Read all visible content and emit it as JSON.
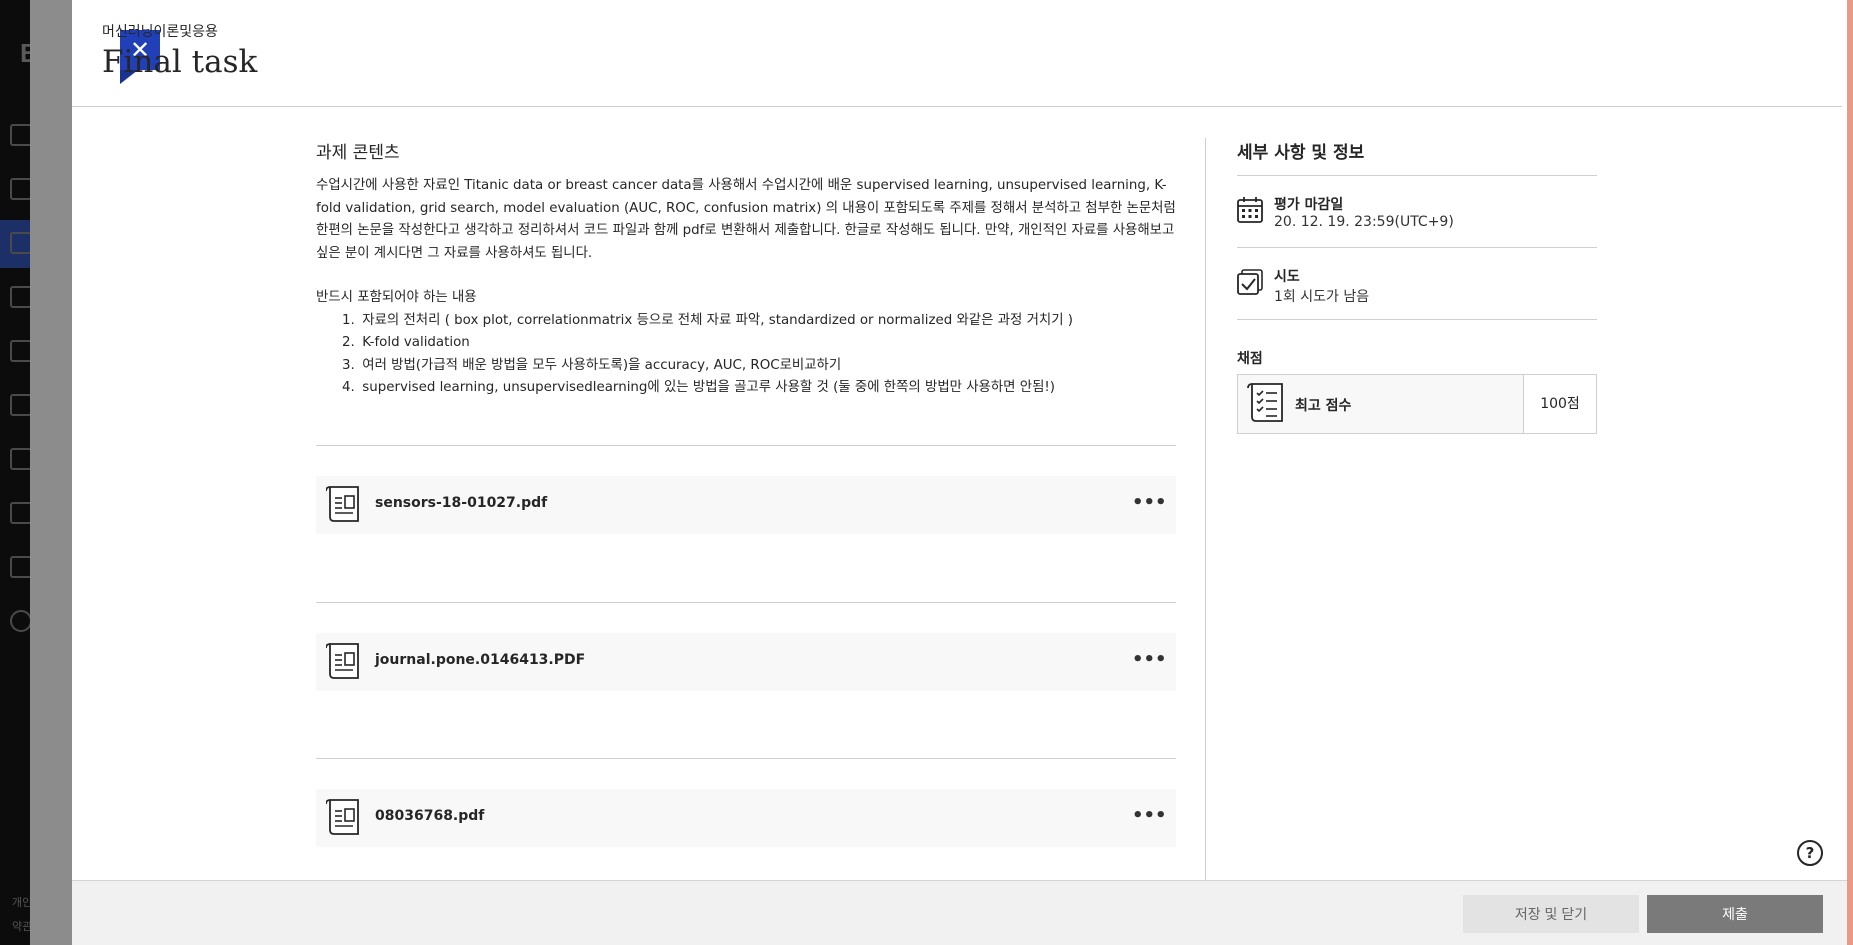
{
  "background": {
    "footer_lines": [
      "개인",
      "약관"
    ]
  },
  "header": {
    "close_symbol": "✕",
    "course_name": "머신러닝이론및응용",
    "title": "Final task"
  },
  "content": {
    "section_title": "과제 콘텐츠",
    "description": "수업시간에 사용한 자료인 Titanic data or breast cancer data를 사용해서 수업시간에 배운 supervised learning, unsupervised learning, K-fold validation, grid search, model evaluation (AUC, ROC, confusion matrix) 의 내용이 포함되도록 주제를 정해서 분석하고 첨부한 논문처럼 한편의 논문을 작성한다고 생각하고 정리하셔서 코드 파일과 함께 pdf로 변환해서 제출합니다. 한글로 작성해도 됩니다. 만약, 개인적인 자료를 사용해보고 싶은 분이 계시다면 그 자료를 사용하셔도 됩니다.",
    "requirements_title": "반드시 포함되어야 하는 내용",
    "requirements": [
      {
        "num": "1.",
        "text": "자료의 전처리 ( box plot, correlationmatrix 등으로 전체 자료 파악, standardized or normalized 와같은 과정 거치기 )"
      },
      {
        "num": "2.",
        "text": "K-fold validation"
      },
      {
        "num": "3.",
        "text": "여러 방법(가급적 배운 방법을 모두 사용하도록)을 accuracy, AUC, ROC로비교하기"
      },
      {
        "num": "4.",
        "text": "supervised learning, unsupervisedlearning에 있는 방법을 골고루 사용할 것 (둘 중에 한쪽의 방법만 사용하면 안됨!)"
      }
    ],
    "files": [
      {
        "name": "sensors-18-01027.pdf",
        "more": "•••"
      },
      {
        "name": "journal.pone.0146413.PDF",
        "more": "•••"
      },
      {
        "name": "08036768.pdf",
        "more": "•••"
      }
    ]
  },
  "sidebar": {
    "title": "세부 사항 및 정보",
    "due": {
      "label": "평가 마감일",
      "value": "20. 12. 19. 23:59(UTC+9)"
    },
    "attempts": {
      "label": "시도",
      "value": "1회 시도가 남음"
    },
    "grading_label": "채점",
    "max_score": {
      "label": "최고 점수",
      "value": "100점"
    }
  },
  "help": {
    "symbol": "?"
  },
  "footer": {
    "save_label": "저장 및 닫기",
    "submit_label": "제출"
  },
  "colors": {
    "accent": "#2140b8",
    "submit_bg": "#7a7a7a",
    "save_bg": "#e3e3e3"
  }
}
